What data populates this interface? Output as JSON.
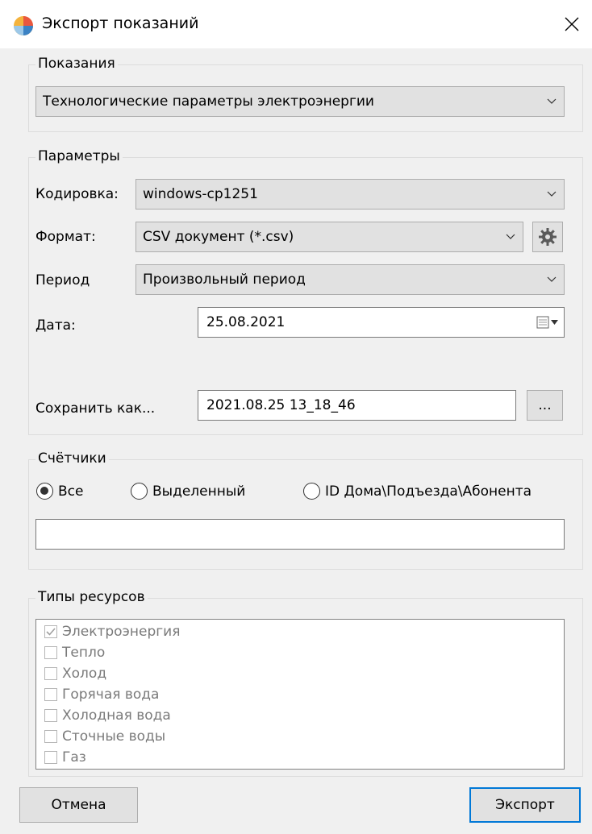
{
  "window": {
    "title": "Экспорт показаний"
  },
  "readings": {
    "legend": "Показания",
    "selected": "Технологические параметры электроэнергии"
  },
  "params": {
    "legend": "Параметры",
    "encoding_label": "Кодировка:",
    "encoding_value": "windows-cp1251",
    "format_label": "Формат:",
    "format_value": "CSV документ (*.csv)",
    "period_label": "Период",
    "period_value": "Произвольный период",
    "date_label": "Дата:",
    "date_value": "25.08.2021",
    "save_as_label": "Сохранить как...",
    "save_as_value": "2021.08.25 13_18_46",
    "browse_label": "..."
  },
  "meters": {
    "legend": "Счётчики",
    "options": [
      {
        "label": "Все",
        "checked": true
      },
      {
        "label": "Выделенный",
        "checked": false
      },
      {
        "label": "ID Дома\\Подъезда\\Абонента",
        "checked": false
      }
    ],
    "filter_value": ""
  },
  "resources": {
    "legend": "Типы ресурсов",
    "items": [
      {
        "label": "Электроэнергия",
        "checked": true
      },
      {
        "label": "Тепло",
        "checked": false
      },
      {
        "label": "Холод",
        "checked": false
      },
      {
        "label": "Горячая вода",
        "checked": false
      },
      {
        "label": "Холодная вода",
        "checked": false
      },
      {
        "label": "Сточные воды",
        "checked": false
      },
      {
        "label": "Газ",
        "checked": false
      }
    ]
  },
  "buttons": {
    "cancel": "Отмена",
    "export": "Экспорт"
  },
  "icons": {
    "app": "app-logo-icon",
    "close": "close-icon",
    "dropdown": "chevron-down-icon",
    "settings": "gear-icon",
    "calendar": "calendar-icon"
  },
  "colors": {
    "accent": "#0078d7",
    "window_bg": "#f0f0f0",
    "titlebar_bg": "#ffffff"
  }
}
